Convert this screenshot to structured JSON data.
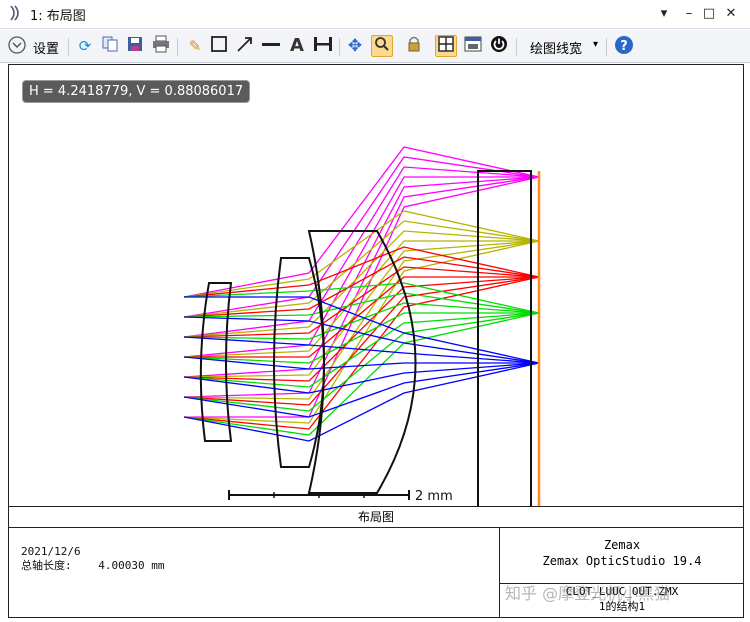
{
  "window": {
    "title": "1: 布局图"
  },
  "toolbar": {
    "settings_label": "设置",
    "line_width_label": "绘图线宽"
  },
  "canvas": {
    "coord_readout": "H = 4.2418779, V = 0.88086017",
    "scale_label": "2 mm",
    "ray_colors": [
      "#ff00ff",
      "#b5b500",
      "#ff0000",
      "#00dd00",
      "#0000ff"
    ]
  },
  "footer": {
    "title": "布局图",
    "date": "2021/12/6",
    "axis_length_label": "总轴长度:",
    "axis_length_value": "4.00030 mm",
    "company": "Zemax",
    "product": "Zemax OpticStudio 19.4",
    "file_name": "CLOT_LUUC_OUT.ZMX",
    "config": "1的结构1"
  },
  "watermark": "知乎 @摩登光机小黑猫"
}
